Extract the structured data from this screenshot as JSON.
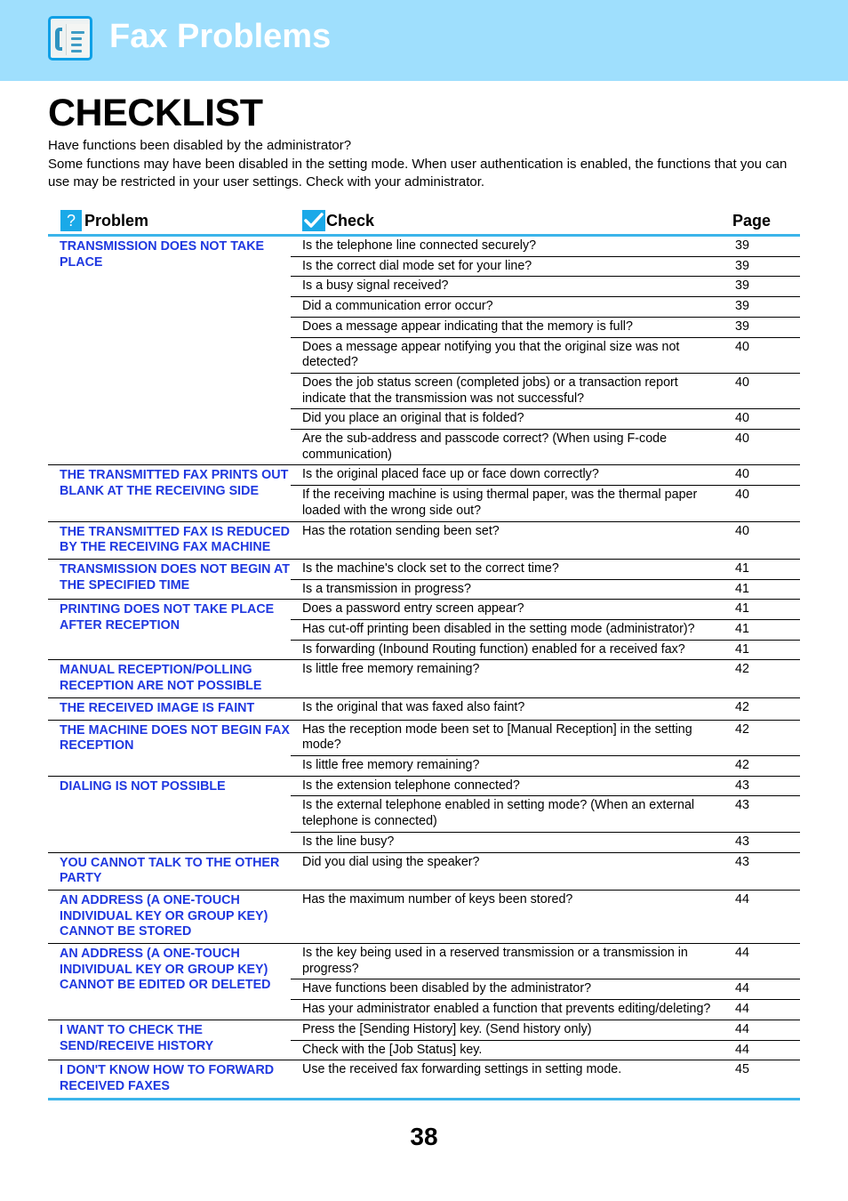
{
  "header": {
    "title": "Fax Problems",
    "icon": "fax-icon",
    "band_color": "#9fdffd"
  },
  "page_title": "CHECKLIST",
  "intro": {
    "line1": "Have functions been disabled by the administrator?",
    "line2": "Some functions may have been disabled in the setting mode. When user authentication is enabled, the functions that you can use may be restricted in your user settings. Check with your administrator."
  },
  "table": {
    "headers": {
      "problem": "Problem",
      "check": "Check",
      "page": "Page",
      "problem_icon": "?",
      "check_icon": "checkmark-icon"
    },
    "accent_color": "#3bb4ea",
    "problem_color": "#1f38e0",
    "groups": [
      {
        "problem": "TRANSMISSION DOES NOT TAKE PLACE",
        "checks": [
          {
            "text": "Is the telephone line connected securely?",
            "page": "39"
          },
          {
            "text": "Is the correct dial mode set for your line?",
            "page": "39"
          },
          {
            "text": "Is a busy signal received?",
            "page": "39"
          },
          {
            "text": "Did a communication error occur?",
            "page": "39"
          },
          {
            "text": "Does a message appear indicating that the memory is full?",
            "page": "39"
          },
          {
            "text": "Does a message appear notifying you that the original size was not detected?",
            "page": "40"
          },
          {
            "text": "Does the job status screen (completed jobs) or a transaction report indicate that the transmission was not successful?",
            "page": "40"
          },
          {
            "text": "Did you place an original that is folded?",
            "page": "40"
          },
          {
            "text": "Are the sub-address and passcode correct? (When using F-code communication)",
            "page": "40"
          }
        ]
      },
      {
        "problem": "THE TRANSMITTED FAX PRINTS OUT BLANK AT THE RECEIVING SIDE",
        "checks": [
          {
            "text": "Is the original placed face up or face down correctly?",
            "page": "40"
          },
          {
            "text": "If the receiving machine is using thermal paper, was the thermal paper loaded with the wrong side out?",
            "page": "40"
          }
        ]
      },
      {
        "problem": "THE TRANSMITTED FAX IS REDUCED BY THE RECEIVING FAX MACHINE",
        "checks": [
          {
            "text": "Has the rotation sending been set?",
            "page": "40"
          }
        ]
      },
      {
        "problem": "TRANSMISSION DOES NOT BEGIN AT THE SPECIFIED TIME",
        "checks": [
          {
            "text": "Is the machine's clock set to the correct time?",
            "page": "41"
          },
          {
            "text": "Is a transmission in progress?",
            "page": "41"
          }
        ]
      },
      {
        "problem": "PRINTING DOES NOT TAKE PLACE AFTER RECEPTION",
        "checks": [
          {
            "text": "Does a password entry screen appear?",
            "page": "41"
          },
          {
            "text": "Has cut-off printing been disabled in the setting mode (administrator)?",
            "page": "41"
          },
          {
            "text": "Is forwarding (Inbound Routing function) enabled for a received fax?",
            "page": "41"
          }
        ]
      },
      {
        "problem": "MANUAL RECEPTION/POLLING RECEPTION ARE NOT POSSIBLE",
        "checks": [
          {
            "text": "Is little free memory remaining?",
            "page": "42"
          }
        ]
      },
      {
        "problem": "THE RECEIVED IMAGE IS FAINT",
        "checks": [
          {
            "text": "Is the original that was faxed also faint?",
            "page": "42"
          }
        ]
      },
      {
        "problem": "THE MACHINE DOES NOT BEGIN FAX RECEPTION",
        "checks": [
          {
            "text": "Has the reception mode been set to [Manual Reception] in the setting mode?",
            "page": "42"
          },
          {
            "text": "Is little free memory remaining?",
            "page": "42"
          }
        ]
      },
      {
        "problem": "DIALING IS NOT POSSIBLE",
        "checks": [
          {
            "text": "Is the extension telephone connected?",
            "page": "43"
          },
          {
            "text": "Is the external telephone enabled in setting mode? (When an external telephone is connected)",
            "page": "43"
          },
          {
            "text": "Is the line busy?",
            "page": "43"
          }
        ]
      },
      {
        "problem": "YOU CANNOT TALK TO THE OTHER PARTY",
        "checks": [
          {
            "text": "Did you dial using the speaker?",
            "page": "43"
          }
        ]
      },
      {
        "problem": "AN ADDRESS (A ONE-TOUCH INDIVIDUAL KEY OR GROUP KEY) CANNOT BE STORED",
        "checks": [
          {
            "text": "Has the maximum number of keys been stored?",
            "page": "44"
          }
        ]
      },
      {
        "problem": "AN ADDRESS (A ONE-TOUCH INDIVIDUAL KEY OR GROUP KEY) CANNOT BE EDITED OR DELETED",
        "checks": [
          {
            "text": "Is the key being used in a reserved transmission or a transmission in progress?",
            "page": "44"
          },
          {
            "text": "Have functions been disabled by the administrator?",
            "page": "44"
          },
          {
            "text": "Has your administrator enabled a function that prevents editing/deleting?",
            "page": "44"
          }
        ]
      },
      {
        "problem": "I WANT TO CHECK THE SEND/RECEIVE HISTORY",
        "checks": [
          {
            "text": "Press the [Sending History] key. (Send history only)",
            "page": "44"
          },
          {
            "text": "Check with the [Job Status] key.",
            "page": "44"
          }
        ]
      },
      {
        "problem": "I DON'T KNOW HOW TO FORWARD RECEIVED FAXES",
        "checks": [
          {
            "text": "Use the received fax forwarding settings in setting mode.",
            "page": "45"
          }
        ]
      }
    ]
  },
  "page_number": "38"
}
